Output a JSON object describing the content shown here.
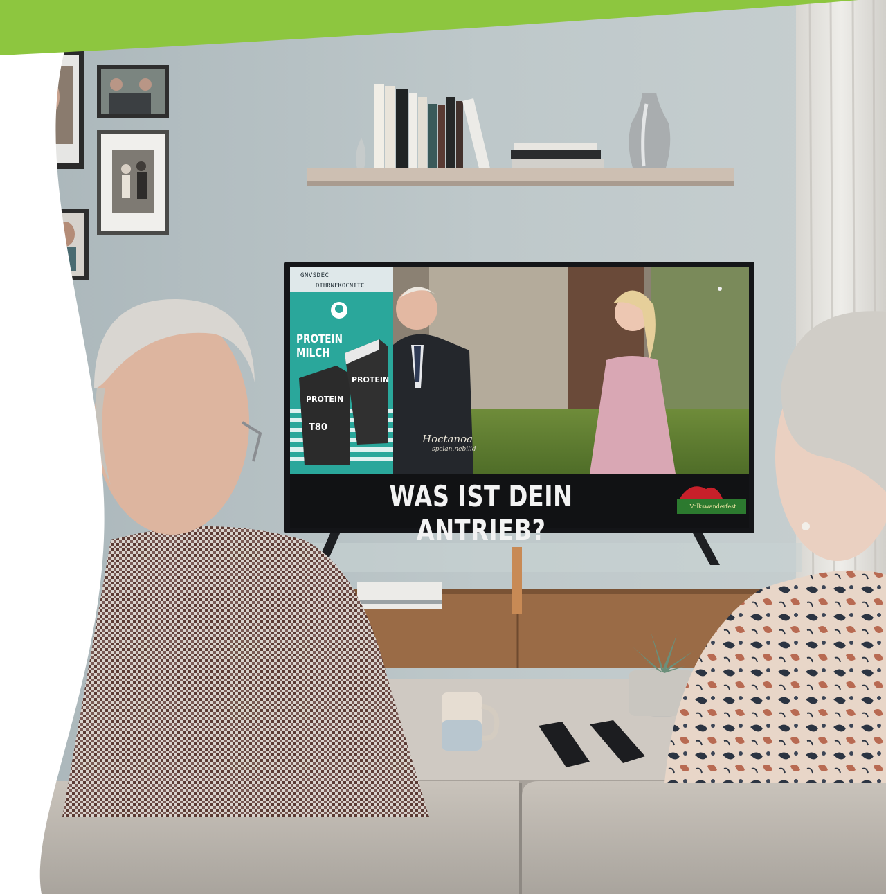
{
  "tv": {
    "ticker_line_1": "GNVSDEC",
    "ticker_line_2": "DIHRNEKOCNITC",
    "ad_text": "PROTEIN\nMILCH",
    "pack_left_label": "PROTEIN",
    "pack_right_label": "PROTEIN",
    "pack_number": "T80",
    "caption_name": "Hoctanoa",
    "caption_sub": "spclan.nebilid",
    "headline": "WAS IST DEIN ANTRIEB?",
    "channel_logo_text": "Volkswanderfest"
  },
  "colors": {
    "brand_green": "#8dc63f",
    "ad_teal": "#2aa79b",
    "wall": "#b9c4c6"
  }
}
